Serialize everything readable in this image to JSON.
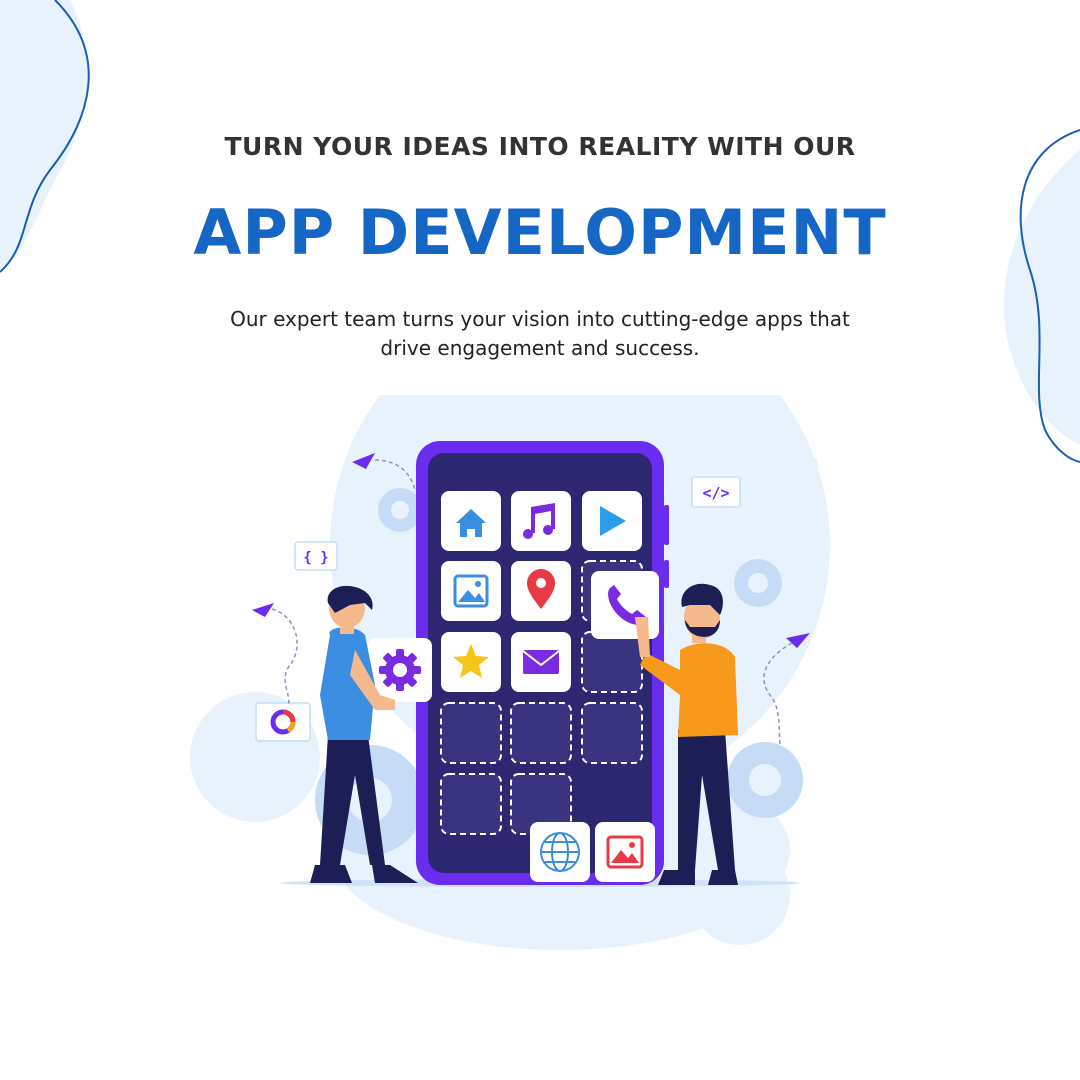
{
  "headline": "TURN YOUR IDEAS INTO REALITY WITH OUR",
  "title": "APP DEVELOPMENT",
  "subtitle": "Our expert team turns your vision into cutting-edge apps that drive engagement and success.",
  "colors": {
    "title": "#1666c5",
    "headline": "#333333",
    "phone": "#6a2df0",
    "screen": "#2d2670",
    "blob": "#e8f2fd",
    "outline": "#1a5fb4"
  },
  "illustration": {
    "badges": {
      "code": "</>",
      "braces": "{ }"
    },
    "app_icons": [
      "home-icon",
      "music-icon",
      "play-icon",
      "image-icon",
      "location-pin-icon",
      "phone-call-icon",
      "star-icon",
      "mail-icon",
      "settings-icon",
      "globe-icon",
      "picture-icon",
      "donut-chart-icon"
    ]
  }
}
